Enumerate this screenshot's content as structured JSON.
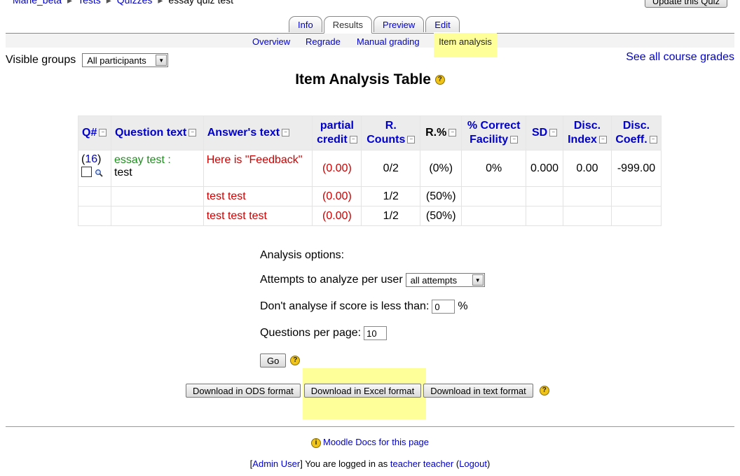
{
  "breadcrumb": {
    "items": [
      "Marie_beta",
      "Tests",
      "Quizzes"
    ],
    "current": "essay quiz test",
    "separator": "▸"
  },
  "update_button": "Update this Quiz",
  "tabs": [
    {
      "label": "Info",
      "active": false
    },
    {
      "label": "Results",
      "active": true
    },
    {
      "label": "Preview",
      "active": false
    },
    {
      "label": "Edit",
      "active": false
    }
  ],
  "subtabs": [
    {
      "label": "Overview",
      "selected": false
    },
    {
      "label": "Regrade",
      "selected": false
    },
    {
      "label": "Manual grading",
      "selected": false
    },
    {
      "label": "Item analysis",
      "selected": true
    }
  ],
  "groups": {
    "label": "Visible groups",
    "selected": "All participants"
  },
  "see_all_grades": "See all course grades",
  "table_title": "Item Analysis Table",
  "table": {
    "headers": {
      "q": "Q#",
      "question_text": "Question text",
      "answer_text": "Answer's text",
      "partial_credit_1": "partial",
      "partial_credit_2": "credit",
      "r_counts_1": "R.",
      "r_counts_2": "Counts",
      "r_pct": "R.%",
      "correct_1": "% Correct",
      "correct_2": "Facility",
      "sd": "SD",
      "disc_index_1": "Disc.",
      "disc_index_2": "Index",
      "disc_coeff_1": "Disc.",
      "disc_coeff_2": "Coeff."
    },
    "question": {
      "number": "16",
      "name": "essay test :",
      "text": "test",
      "facility": "0%",
      "sd": "0.000",
      "disc_index": "0.00",
      "disc_coeff": "-999.00"
    },
    "answers": [
      {
        "text": "Here is \"Feedback\"",
        "credit": "(0.00)",
        "counts": "0/2",
        "pct": "(0%)"
      },
      {
        "text": "test test",
        "credit": "(0.00)",
        "counts": "1/2",
        "pct": "(50%)"
      },
      {
        "text": "test test test",
        "credit": "(0.00)",
        "counts": "1/2",
        "pct": "(50%)"
      }
    ]
  },
  "options": {
    "heading": "Analysis options:",
    "attempts_label": "Attempts to analyze per user",
    "attempts_value": "all attempts",
    "min_score_label": "Don't analyse if score is less than:",
    "min_score_value": "0",
    "min_score_unit": "%",
    "per_page_label": "Questions per page:",
    "per_page_value": "10",
    "go_button": "Go"
  },
  "downloads": {
    "ods": "Download in ODS format",
    "excel": "Download in Excel format",
    "text": "Download in text format"
  },
  "footer": {
    "docs_link": "Moodle Docs for this page",
    "admin_user": "Admin User",
    "logged_in_text": " You are logged in as ",
    "user_name": "teacher teacher",
    "logout": "Logout"
  },
  "colors": {
    "link": "#0000cc",
    "highlight": "#ffff99",
    "answer_red": "#cc0000",
    "question_green": "#228B22"
  }
}
